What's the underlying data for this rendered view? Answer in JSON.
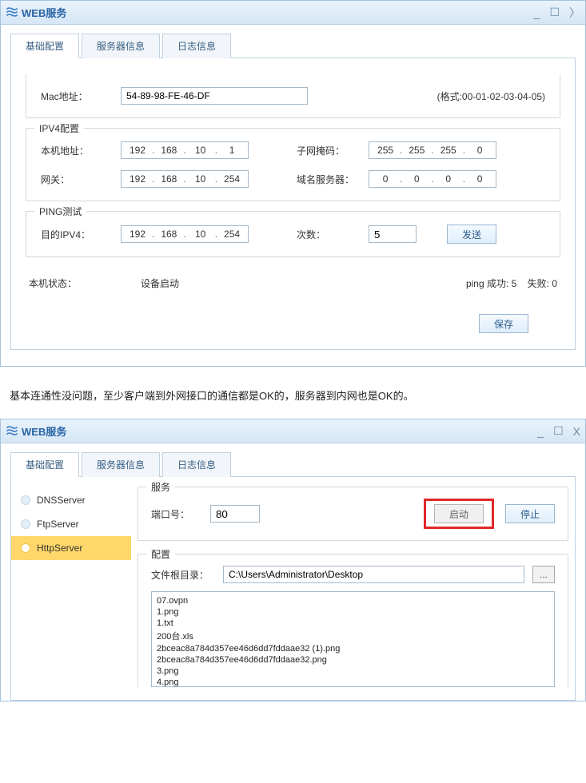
{
  "window1": {
    "title": "WEB服务",
    "tabs": [
      {
        "label": "基础配置",
        "active": true
      },
      {
        "label": "服务器信息",
        "active": false
      },
      {
        "label": "日志信息",
        "active": false
      }
    ],
    "mac": {
      "label": "Mac地址：",
      "value": "54-89-98-FE-46-DF",
      "hint": "(格式:00-01-02-03-04-05)"
    },
    "ipv4": {
      "group_title": "IPV4配置",
      "local_label": "本机地址：",
      "local_ip": [
        "192",
        "168",
        "10",
        "1"
      ],
      "mask_label": "子网掩码：",
      "mask_ip": [
        "255",
        "255",
        "255",
        "0"
      ],
      "gateway_label": "网关：",
      "gateway_ip": [
        "192",
        "168",
        "10",
        "254"
      ],
      "dns_label": "域名服务器：",
      "dns_ip": [
        "0",
        "0",
        "0",
        "0"
      ]
    },
    "ping": {
      "group_title": "PING测试",
      "target_label": "目的IPV4：",
      "target_ip": [
        "192",
        "168",
        "10",
        "254"
      ],
      "count_label": "次数：",
      "count_value": "5",
      "send_btn": "发送"
    },
    "status": {
      "label": "本机状态：",
      "value": "设备启动",
      "ping_result": "ping 成功: 5    失败: 0"
    },
    "save_btn": "保存"
  },
  "note": "基本连通性没问题，至少客户端到外网接口的通信都是OK的，服务器到内网也是OK的。",
  "window2": {
    "title": "WEB服务",
    "tabs": [
      {
        "label": "基础配置",
        "active": true
      },
      {
        "label": "服务器信息",
        "active": false
      },
      {
        "label": "日志信息",
        "active": false
      }
    ],
    "sidebar": {
      "items": [
        {
          "label": "DNSServer",
          "active": false
        },
        {
          "label": "FtpServer",
          "active": false
        },
        {
          "label": "HttpServer",
          "active": true
        }
      ]
    },
    "service": {
      "group_title": "服务",
      "port_label": "端口号：",
      "port_value": "80",
      "start_btn": "启动",
      "stop_btn": "停止"
    },
    "config": {
      "group_title": "配置",
      "root_label": "文件根目录：",
      "root_value": "C:\\Users\\Administrator\\Desktop",
      "files": [
        "07.ovpn",
        "1.png",
        "1.txt",
        "200台.xls",
        "2bceac8a784d357ee46d6dd7fddaae32 (1).png",
        "2bceac8a784d357ee46d6dd7fddaae32.png",
        "3.png",
        "4.png"
      ]
    }
  }
}
